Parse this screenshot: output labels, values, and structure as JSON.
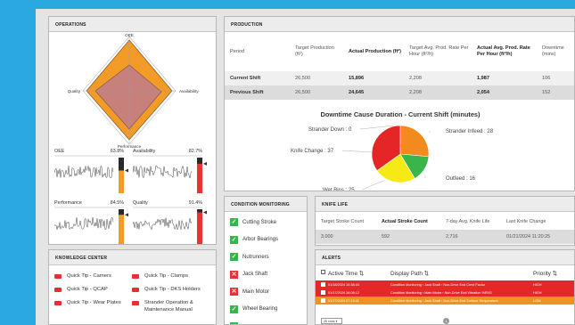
{
  "operations": {
    "title": "OPERATIONS",
    "radar_labels": {
      "top": "OEE",
      "right": "Availability",
      "bottom": "Performance",
      "left": "Quality"
    },
    "gauges": [
      {
        "label": "OEE",
        "value": "63.8%",
        "level": 0.638,
        "color": "#f39b27"
      },
      {
        "label": "Availability",
        "value": "82.7%",
        "level": 0.827,
        "color": "#e63232"
      },
      {
        "label": "Performance",
        "value": "84.5%",
        "level": 0.845,
        "color": "#f39b27"
      },
      {
        "label": "Quality",
        "value": "91.4%",
        "level": 0.914,
        "color": "#e63232"
      }
    ]
  },
  "production": {
    "title": "PRODUCTION",
    "headers": [
      "Period",
      "Target Production (ft²)",
      "Actual Production (ft²)",
      "Target Avg. Prod. Rate Per Hour (ft²/h)",
      "Actual Avg. Prod. Rate Per Hour (ft²/h)",
      "Downtime (mins)"
    ],
    "rows": [
      {
        "period": "Current Shift",
        "target": "26,500",
        "actual": "15,896",
        "target_rate": "2,208",
        "actual_rate": "1,987",
        "downtime": "106"
      },
      {
        "period": "Previous Shift",
        "target": "26,500",
        "actual": "24,645",
        "target_rate": "2,208",
        "actual_rate": "2,054",
        "downtime": "152"
      }
    ],
    "chart_title": "Downtime Cause Duration - Current Shift (minutes)",
    "chart_data": {
      "type": "pie",
      "title": "Downtime Cause Duration - Current Shift (minutes)",
      "slices": [
        {
          "label": "Strander Infeed : 28",
          "name": "Strander Infeed",
          "value": 28,
          "color": "#f28a1e"
        },
        {
          "label": "Outfeed : 16",
          "name": "Outfeed",
          "value": 16,
          "color": "#3ab54a"
        },
        {
          "label": "Wet Bins : 25",
          "name": "Wet Bins",
          "value": 25,
          "color": "#f5ea14"
        },
        {
          "label": "Knife Change : 37",
          "name": "Knife Change",
          "value": 37,
          "color": "#e52626"
        },
        {
          "label": "Strander Down : 0",
          "name": "Strander Down",
          "value": 0,
          "color": "#999999"
        }
      ]
    }
  },
  "condition": {
    "title": "CONDITION MONITORING",
    "items": [
      {
        "label": "Cutting Stroke",
        "status": "ok",
        "mark": "✓"
      },
      {
        "label": "Arbor Bearings",
        "status": "ok",
        "mark": "✓"
      },
      {
        "label": "Nutrunners",
        "status": "ok",
        "mark": "✓"
      },
      {
        "label": "Jack Shaft",
        "status": "bad",
        "mark": "✕"
      },
      {
        "label": "Main Motor",
        "status": "bad",
        "mark": "✕"
      },
      {
        "label": "Wheel Bearing",
        "status": "ok",
        "mark": "✓"
      },
      {
        "label": "Batch Feeder",
        "status": "ok",
        "mark": "✓"
      }
    ]
  },
  "knife": {
    "title": "KNIFE LIFE",
    "headers": [
      "Target Stroke Count",
      "Actual Stroke Count",
      "7-day Avg. Knife Life",
      "Last Knife Change"
    ],
    "values": [
      "3,000",
      "592",
      "2,716",
      "01/21/2024 11:20:25"
    ]
  },
  "knowledge": {
    "title": "KNOWLEDGE CENTER",
    "items": [
      "Quick Tip - Carners",
      "Quick Tip - Clamps",
      "Quick Tip - QCAP",
      "Quick Tip - DKS Holders",
      "Quick Tip - Wear Plates",
      "Strander Operation & Maintenance Manual"
    ]
  },
  "alerts": {
    "title": "ALERTS",
    "headers": {
      "time": "Active Time ⇅",
      "path": "Display Path ⇅",
      "priority": "Priority ⇅"
    },
    "rows": [
      {
        "time": "01/18/2024 10:38:44",
        "path": "Condition Monitoring › Jack Shaft › Non-Drive End Crest Factor",
        "priority": "HIGH",
        "color": "red"
      },
      {
        "time": "01/17/2024 16:08:12",
        "path": "Condition Monitoring › Main Motor › Non-Drive End Vibration %ENS",
        "priority": "HIGH",
        "color": "red"
      },
      {
        "time": "01/17/2024 07:13:41",
        "path": "Condition Monitoring › Jack Shaft › Non-Drive End Surface Temperature",
        "priority": "LOW",
        "color": "orange"
      }
    ],
    "page_size": "25 rows",
    "page": "1"
  }
}
